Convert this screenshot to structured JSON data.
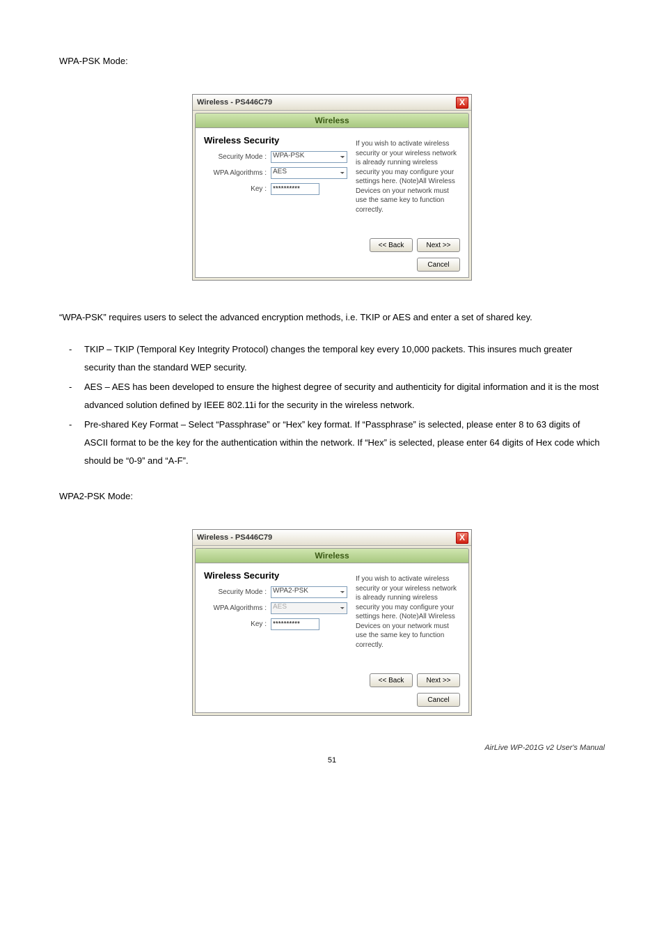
{
  "heading1": "WPA-PSK Mode:",
  "dialog1": {
    "title": "Wireless - PS446C79",
    "close": "X",
    "tab": "Wireless",
    "secHeading": "Wireless Security",
    "securityModeLabel": "Security Mode :",
    "securityModeValue": "WPA-PSK",
    "wpaAlgLabel": "WPA Algorithms :",
    "wpaAlgValue": "AES",
    "keyLabel": "Key :",
    "keyValue": "**********",
    "help": "If you wish to activate wireless security or your wireless network is already running wireless security you may configure your settings here. (Note)All Wireless Devices on your network must use the same key to function correctly.",
    "back": "<< Back",
    "next": "Next >>",
    "cancel": "Cancel"
  },
  "para1": "“WPA-PSK” requires users to select the advanced encryption methods, i.e. TKIP or AES and enter a set of shared key.",
  "bullets": [
    "TKIP – TKIP (Temporal Key Integrity Protocol) changes the temporal key every 10,000 packets. This insures much greater security than the standard WEP security.",
    "AES – AES has been developed to ensure the highest degree of security and authenticity for digital information and it is the most advanced solution defined by IEEE 802.11i for the security in the wireless network.",
    "Pre-shared Key Format – Select “Passphrase” or “Hex” key format. If “Passphrase” is selected, please enter 8 to 63 digits of ASCII format to be the key for the authentication within the network. If “Hex” is selected, please enter 64 digits of Hex code which should be “0-9” and “A-F”."
  ],
  "heading2": "WPA2-PSK Mode:",
  "dialog2": {
    "title": "Wireless - PS446C79",
    "close": "X",
    "tab": "Wireless",
    "secHeading": "Wireless Security",
    "securityModeLabel": "Security Mode :",
    "securityModeValue": "WPA2-PSK",
    "wpaAlgLabel": "WPA Algorithms :",
    "wpaAlgValue": "AES",
    "keyLabel": "Key :",
    "keyValue": "**********",
    "help": "If you wish to activate wireless security or your wireless network is already running wireless security you may configure your settings here. (Note)All Wireless Devices on your network must use the same key to function correctly.",
    "back": "<< Back",
    "next": "Next >>",
    "cancel": "Cancel"
  },
  "footer": "AirLive WP-201G v2 User's Manual",
  "pageNumber": "51"
}
